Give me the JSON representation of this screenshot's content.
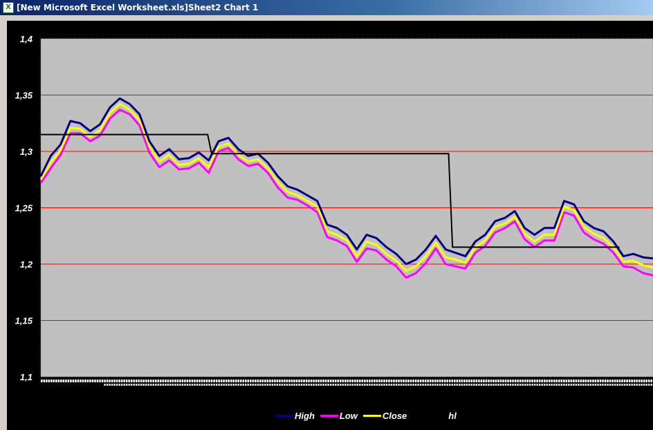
{
  "window": {
    "title": "[New Microsoft Excel Worksheet.xls]Sheet2 Chart 1",
    "icon": "excel-icon"
  },
  "chart_data": {
    "type": "line",
    "title": "",
    "xlabel": "",
    "ylabel": "",
    "ylim": [
      1.1,
      1.4
    ],
    "y_ticks": [
      "1,4",
      "1,35",
      "1,3",
      "1,25",
      "1,2",
      "1,15",
      "1,1"
    ],
    "y_tick_values": [
      1.4,
      1.35,
      1.3,
      1.25,
      1.2,
      1.15,
      1.1
    ],
    "grid": true,
    "grid_color": "#ff0000",
    "plot_bg": "#c0c0c0",
    "legend_position": "bottom",
    "series": [
      {
        "name": "High",
        "color": "#000080",
        "values": [
          1.278,
          1.296,
          1.306,
          1.327,
          1.325,
          1.318,
          1.324,
          1.339,
          1.347,
          1.342,
          1.333,
          1.309,
          1.296,
          1.302,
          1.293,
          1.294,
          1.299,
          1.292,
          1.309,
          1.312,
          1.302,
          1.296,
          1.298,
          1.29,
          1.278,
          1.269,
          1.266,
          1.261,
          1.256,
          1.235,
          1.232,
          1.226,
          1.213,
          1.226,
          1.223,
          1.215,
          1.209,
          1.2,
          1.204,
          1.213,
          1.225,
          1.213,
          1.21,
          1.207,
          1.22,
          1.226,
          1.238,
          1.241,
          1.247,
          1.232,
          1.226,
          1.232,
          1.232,
          1.256,
          1.253,
          1.238,
          1.232,
          1.229,
          1.22,
          1.207,
          1.209,
          1.206,
          1.205
        ]
      },
      {
        "name": "Low",
        "color": "#ff00ff",
        "values": [
          1.272,
          1.285,
          1.297,
          1.316,
          1.316,
          1.309,
          1.314,
          1.329,
          1.337,
          1.333,
          1.323,
          1.299,
          1.286,
          1.292,
          1.284,
          1.285,
          1.29,
          1.281,
          1.3,
          1.303,
          1.293,
          1.287,
          1.289,
          1.281,
          1.268,
          1.259,
          1.257,
          1.252,
          1.246,
          1.224,
          1.221,
          1.216,
          1.202,
          1.214,
          1.212,
          1.204,
          1.198,
          1.188,
          1.192,
          1.201,
          1.214,
          1.2,
          1.198,
          1.196,
          1.21,
          1.216,
          1.228,
          1.232,
          1.238,
          1.222,
          1.215,
          1.221,
          1.221,
          1.246,
          1.243,
          1.228,
          1.222,
          1.218,
          1.21,
          1.198,
          1.197,
          1.192,
          1.19
        ]
      },
      {
        "name": "Close",
        "color": "#ffff00",
        "values": [
          1.275,
          1.29,
          1.301,
          1.321,
          1.32,
          1.313,
          1.319,
          1.334,
          1.342,
          1.337,
          1.328,
          1.304,
          1.291,
          1.297,
          1.288,
          1.289,
          1.294,
          1.286,
          1.304,
          1.307,
          1.297,
          1.291,
          1.293,
          1.285,
          1.273,
          1.264,
          1.261,
          1.256,
          1.251,
          1.229,
          1.226,
          1.221,
          1.207,
          1.22,
          1.217,
          1.209,
          1.203,
          1.194,
          1.198,
          1.207,
          1.219,
          1.206,
          1.204,
          1.201,
          1.215,
          1.221,
          1.233,
          1.236,
          1.242,
          1.227,
          1.22,
          1.226,
          1.226,
          1.251,
          1.248,
          1.233,
          1.227,
          1.223,
          1.215,
          1.202,
          1.203,
          1.199,
          1.197
        ]
      },
      {
        "name": "hl",
        "color": "#000000",
        "step_points": [
          [
            0,
            1.315
          ],
          [
            16.9,
            1.315
          ],
          [
            17.3,
            1.298
          ],
          [
            41.3,
            1.298
          ],
          [
            41.7,
            1.215
          ],
          [
            58.6,
            1.215
          ]
        ]
      }
    ]
  }
}
